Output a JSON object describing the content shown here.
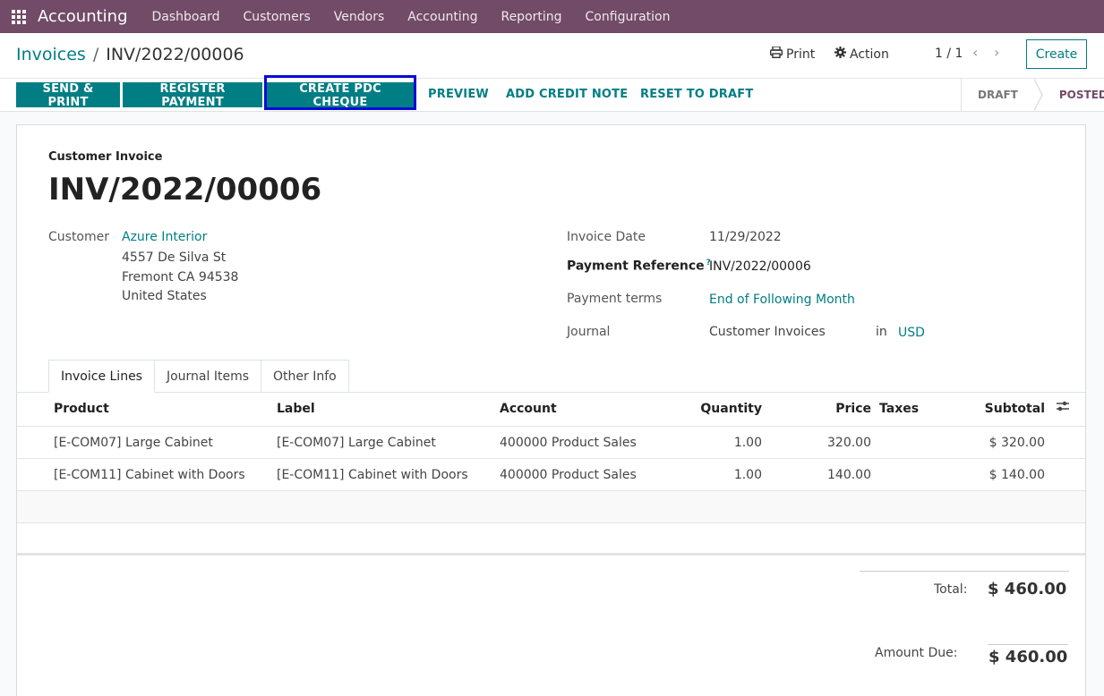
{
  "navbar": {
    "app_name": "Accounting",
    "menu": [
      "Dashboard",
      "Customers",
      "Vendors",
      "Accounting",
      "Reporting",
      "Configuration"
    ]
  },
  "breadcrumb": {
    "parent": "Invoices",
    "separator": "/",
    "current": "INV/2022/00006"
  },
  "actions": {
    "print": "Print",
    "action": "Action",
    "pager": "1 / 1",
    "create": "Create"
  },
  "buttons": {
    "send_print": "SEND & PRINT",
    "register_payment": "REGISTER PAYMENT",
    "create_pdc_cheque": "CREATE PDC CHEQUE",
    "preview": "PREVIEW",
    "add_credit_note": "ADD CREDIT NOTE",
    "reset_to_draft": "RESET TO DRAFT"
  },
  "status": {
    "draft": "DRAFT",
    "posted": "POSTED",
    "current": "POSTED"
  },
  "invoice": {
    "type": "Customer Invoice",
    "name": "INV/2022/00006",
    "customer_label": "Customer",
    "customer_name": "Azure Interior",
    "address_line1": "4557 De Silva St",
    "address_line2": "Fremont CA 94538",
    "address_line3": "United States",
    "invoice_date_label": "Invoice Date",
    "invoice_date": "11/29/2022",
    "payment_ref_label": "Payment Reference",
    "payment_ref_help": "?",
    "payment_ref": "INV/2022/00006",
    "payment_terms_label": "Payment terms",
    "payment_terms": "End of Following Month",
    "journal_label": "Journal",
    "journal": "Customer Invoices",
    "journal_in": "in",
    "currency": "USD"
  },
  "tabs": [
    "Invoice Lines",
    "Journal Items",
    "Other Info"
  ],
  "table": {
    "headers": {
      "product": "Product",
      "label": "Label",
      "account": "Account",
      "quantity": "Quantity",
      "price": "Price",
      "taxes": "Taxes",
      "subtotal": "Subtotal"
    },
    "rows": [
      {
        "product": "[E-COM07] Large Cabinet",
        "label": "[E-COM07] Large Cabinet",
        "account": "400000 Product Sales",
        "quantity": "1.00",
        "price": "320.00",
        "taxes": "",
        "subtotal": "$ 320.00"
      },
      {
        "product": "[E-COM11] Cabinet with Doors",
        "label": "[E-COM11] Cabinet with Doors",
        "account": "400000 Product Sales",
        "quantity": "1.00",
        "price": "140.00",
        "taxes": "",
        "subtotal": "$ 140.00"
      }
    ]
  },
  "totals": {
    "total_label": "Total:",
    "total": "$ 460.00",
    "amount_due_label": "Amount Due:",
    "amount_due": "$ 460.00"
  },
  "colors": {
    "navbar": "#714b67",
    "accent": "#017e84",
    "highlight": "#0a0ad8"
  }
}
